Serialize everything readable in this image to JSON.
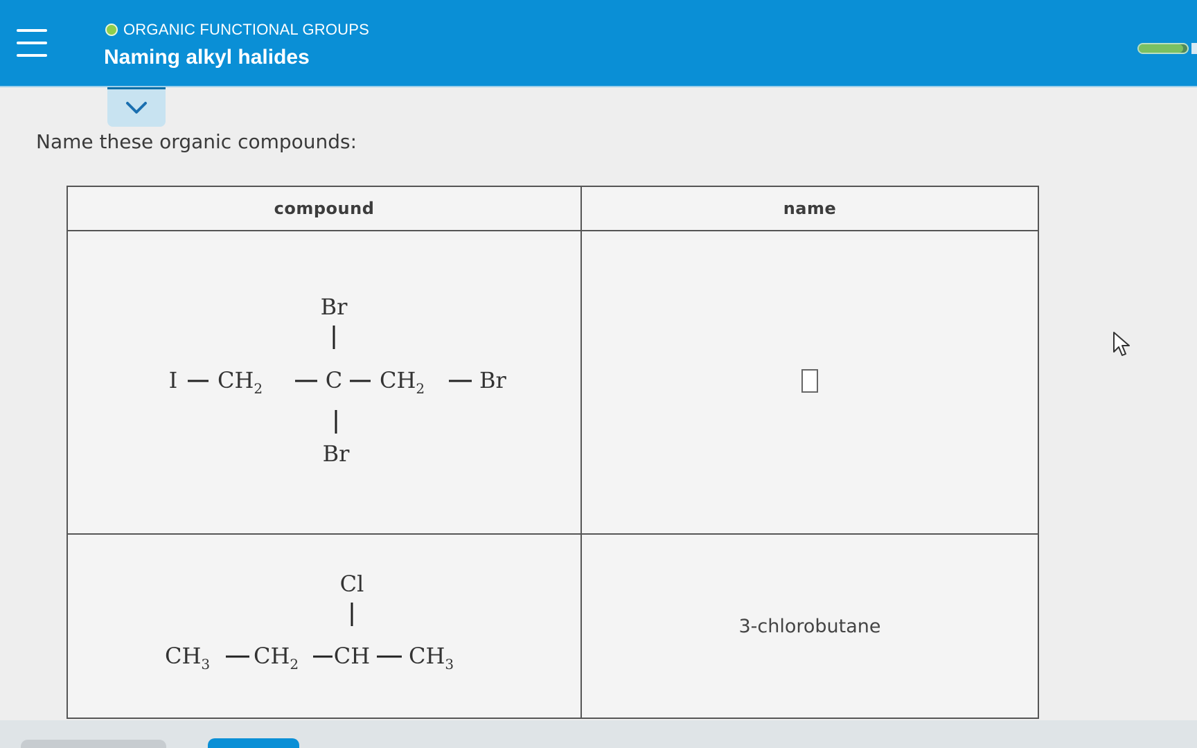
{
  "header": {
    "topic": "ORGANIC FUNCTIONAL GROUPS",
    "title": "Naming alkyl halides",
    "progress_fraction": 0.92
  },
  "prompt": "Name these organic compounds:",
  "table": {
    "headers": [
      "compound",
      "name"
    ],
    "rows": [
      {
        "compound": {
          "top": "Br",
          "main": [
            "I",
            "CH",
            "2",
            "C",
            "CH",
            "2",
            "Br"
          ],
          "bottom": "Br"
        },
        "name": ""
      },
      {
        "compound": {
          "top": "Cl",
          "main": [
            "CH",
            "3",
            "CH",
            "2",
            "CH",
            "CH",
            "3"
          ]
        },
        "name": "3-chlorobutane"
      }
    ]
  },
  "colors": {
    "header_bg": "#0a8fd6",
    "accent_green": "#8fcf4d"
  }
}
